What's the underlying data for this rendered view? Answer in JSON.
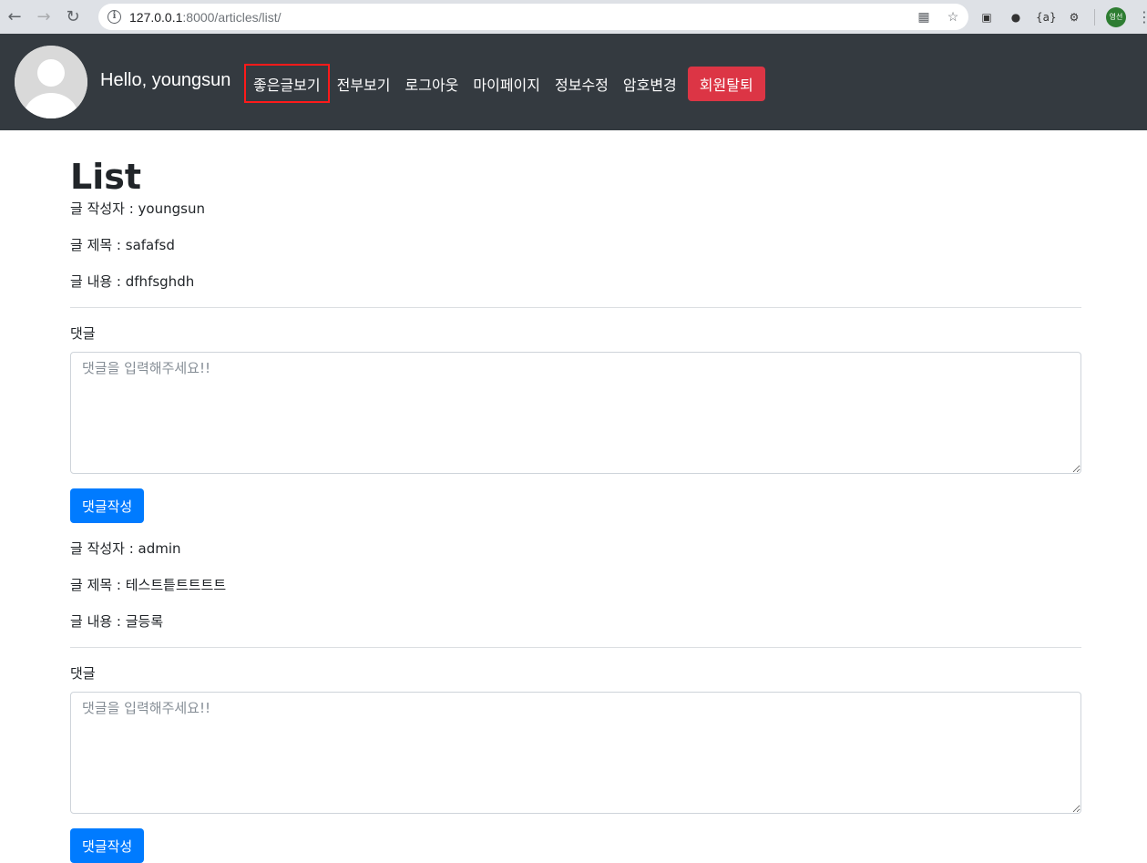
{
  "browser": {
    "url_host": "127.0.0.1",
    "url_rest": ":8000/articles/list/",
    "profile_label": "영선"
  },
  "navbar": {
    "greeting": "Hello, youngsun",
    "links": [
      "좋은글보기",
      "전부보기",
      "로그아웃",
      "마이페이지",
      "정보수정",
      "암호변경"
    ],
    "delete_account": "회원탈퇴"
  },
  "page": {
    "title": "List"
  },
  "articles": [
    {
      "author": "글 작성자 : youngsun",
      "title": "글 제목 : safafsd",
      "body": "글 내용 : dfhfsghdh",
      "comment_label": "댓글",
      "comment_placeholder": "댓글을 입력해주세요!!",
      "submit_label": "댓글작성"
    },
    {
      "author": "글 작성자 : admin",
      "title": "글 제목 : 테스트틑트트트트",
      "body": "글 내용 : 글등록",
      "comment_label": "댓글",
      "comment_placeholder": "댓글을 입력해주세요!!",
      "submit_label": "댓글작성"
    }
  ],
  "colors": {
    "navbar_bg": "#343a40",
    "danger": "#dc3545",
    "primary": "#007bff",
    "highlight_box": "#ff1a1a"
  }
}
